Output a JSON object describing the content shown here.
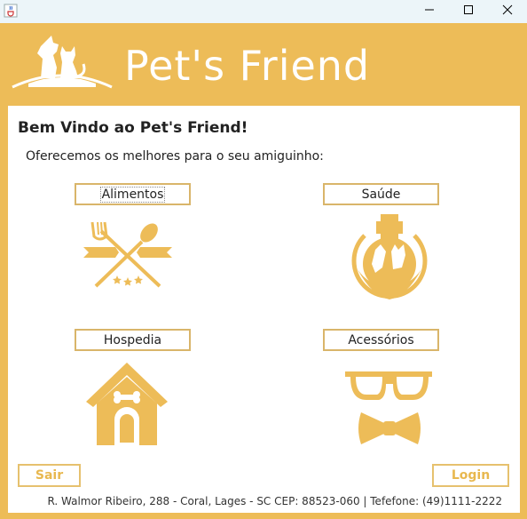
{
  "window": {
    "app_icon": "java-cup-icon",
    "controls": [
      "minimize-icon",
      "maximize-icon",
      "close-icon"
    ]
  },
  "header": {
    "brand": "Pet's Friend",
    "logo_icon": "dog-cat-logo-icon"
  },
  "main": {
    "welcome": "Bem Vindo ao Pet's Friend!",
    "subtitle": "Oferecemos os melhores para o seu amiguinho:",
    "categories": {
      "alimentos": {
        "label": "Alimentos",
        "icon": "fork-spoon-icon"
      },
      "saude": {
        "label": "Saúde",
        "icon": "pet-health-icon"
      },
      "hospedia": {
        "label": "Hospedia",
        "icon": "doghouse-icon"
      },
      "acessorios": {
        "label": "Acessórios",
        "icon": "glasses-bowtie-icon"
      }
    },
    "sair_label": "Sair",
    "login_label": "Login",
    "footer": "R. Walmor Ribeiro, 288 - Coral, Lages - SC CEP: 88523-060 | Tefefone: (49)1111-2222"
  },
  "colors": {
    "accent": "#EDBC58",
    "button_border": "#D9B56A",
    "panel": "#FFFFFF"
  }
}
